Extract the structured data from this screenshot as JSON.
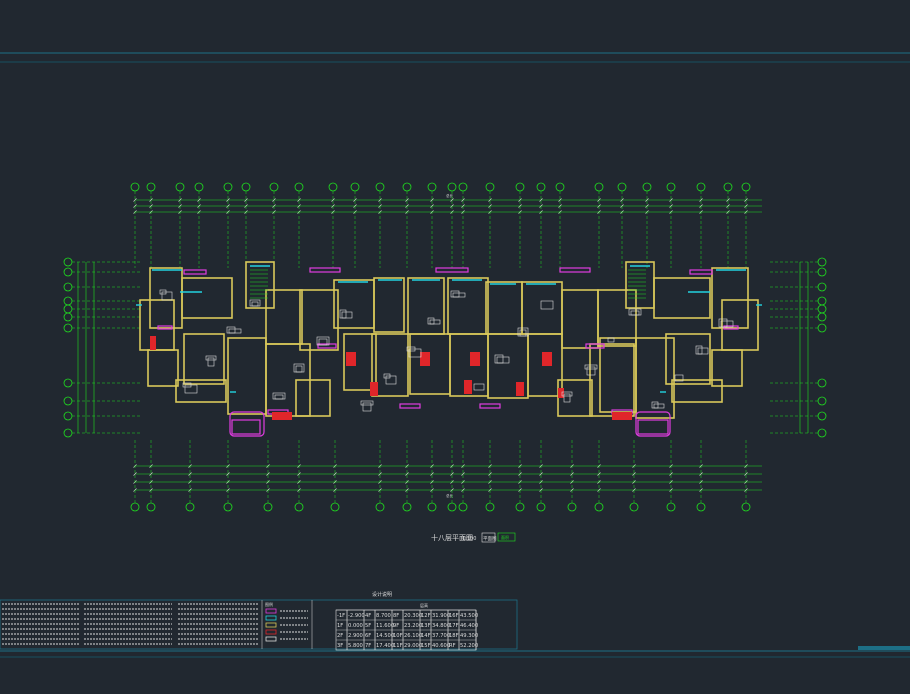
{
  "drawing": {
    "plan_title": "十八层平面图",
    "plan_scale": "1:100",
    "plan_tag": "平面图",
    "plan_area_label": "面积",
    "notes_header": "设计说明",
    "legend_header": "图例",
    "elevation_table_header": "层高",
    "total_top_label": "总长",
    "total_bottom_label": "总长"
  },
  "elevations": [
    [
      "-1F",
      "-2.900",
      "4F",
      "8.700",
      "8F",
      "20.300",
      "12F",
      "31.900",
      "16F",
      "43.500"
    ],
    [
      "1F",
      "0.000",
      "5F",
      "11.600",
      "9F",
      "23.200",
      "13F",
      "34.800",
      "17F",
      "46.400"
    ],
    [
      "2F",
      "2.900",
      "6F",
      "14.500",
      "10F",
      "26.100",
      "14F",
      "37.700",
      "18F",
      "49.300"
    ],
    [
      "3F",
      "5.800",
      "7F",
      "17.400",
      "11F",
      "29.000",
      "15F",
      "40.600",
      "RF",
      "52.200"
    ]
  ],
  "colors": {
    "background": "#212830",
    "axis_green": "#1fe01f",
    "wall_yellow": "#d9c85a",
    "window_cyan": "#22d3e0",
    "door_magenta": "#e03ce0",
    "furniture_white": "#dcdcdc",
    "hatch_red": "#e0262a",
    "frame_teal": "#1d6f86"
  }
}
